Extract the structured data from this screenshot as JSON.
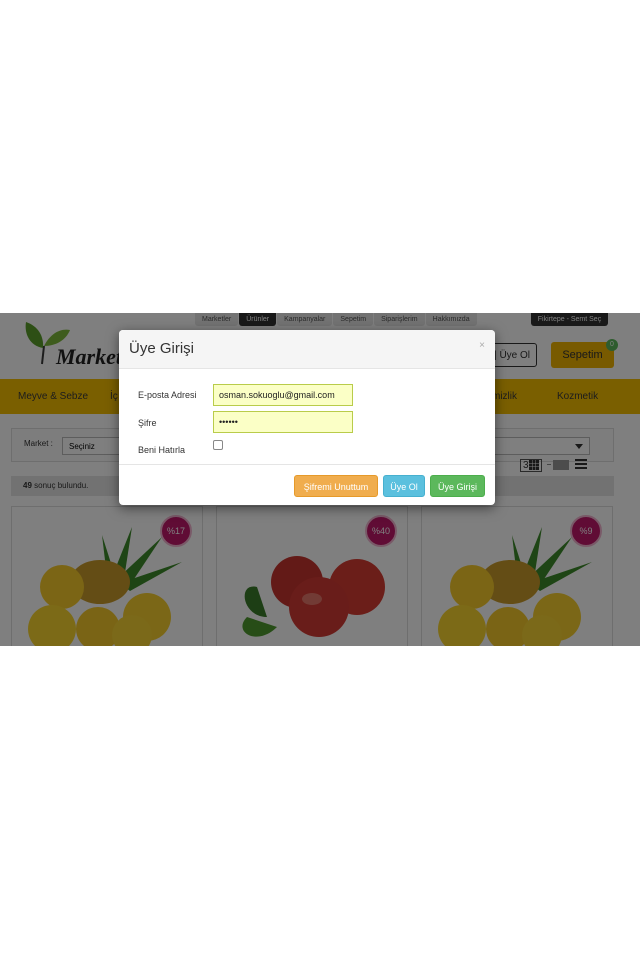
{
  "topnav": {
    "tabs": [
      {
        "label": "Marketler"
      },
      {
        "label": "Ürünler"
      },
      {
        "label": "Kampanyalar"
      },
      {
        "label": "Sepetim"
      },
      {
        "label": "Siparişlerim"
      },
      {
        "label": "Hakkımızda"
      }
    ],
    "location": "Fikirtepe - Semt Seç"
  },
  "header": {
    "logo_text": "Market",
    "auth_label": "| Üye Ol",
    "cart_label": "Sepetim",
    "cart_count": "0"
  },
  "categories": [
    {
      "label": "Meyve & Sebze"
    },
    {
      "label": "İç"
    },
    {
      "label": "mizlik"
    },
    {
      "label": "Kozmetik"
    }
  ],
  "filter": {
    "market_label": "Market :",
    "market_value": "Seçiniz",
    "view_columns": "3"
  },
  "results": {
    "count": "49",
    "text": " sonuç bulundu."
  },
  "products": [
    {
      "discount": "%17",
      "image": "pineapple"
    },
    {
      "discount": "%40",
      "image": "apples"
    },
    {
      "discount": "%9",
      "image": "pineapple"
    }
  ],
  "modal": {
    "title": "Üye Girişi",
    "close": "×",
    "email_label": "E-posta Adresi",
    "email_value": "osman.sokuoglu@gmail.com",
    "password_label": "Şifre",
    "password_value": "••••••",
    "remember_label": "Beni Hatırla",
    "forgot_button": "Şifremi Unuttum",
    "register_button": "Üye Ol",
    "login_button": "Üye Girişi"
  },
  "colors": {
    "accent_yellow": "#f4be00",
    "discount_badge": "#c0196a",
    "btn_warning": "#f0ad4e",
    "btn_info": "#5bc0de",
    "btn_success": "#5cb85c",
    "autofill_input": "#fbffc6"
  }
}
